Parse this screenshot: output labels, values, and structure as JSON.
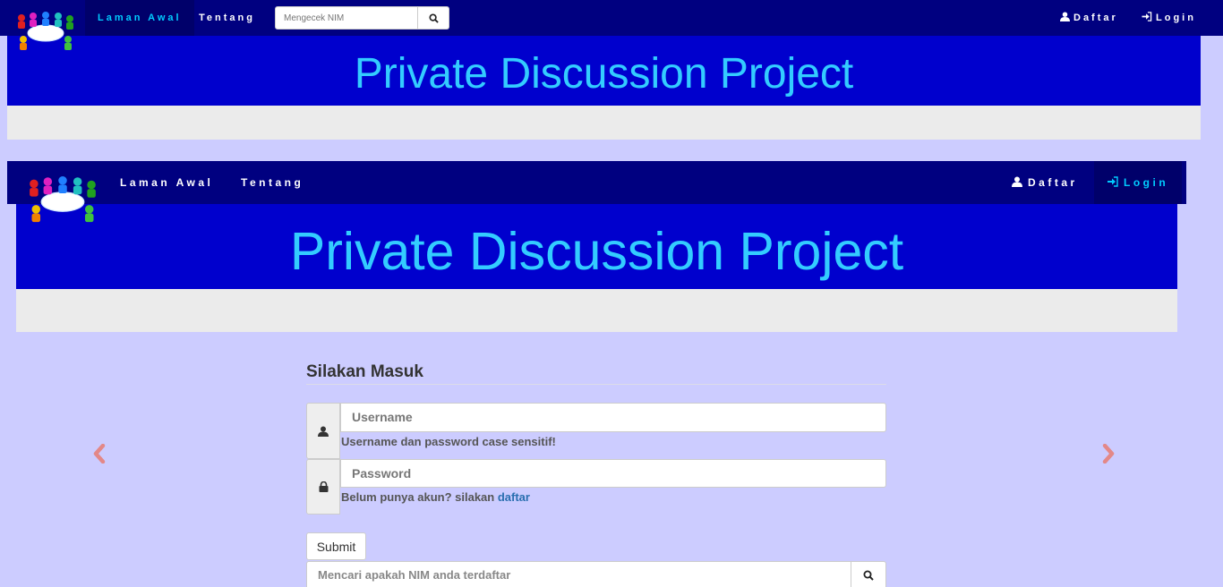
{
  "topnav": {
    "logo": "meeting-people-logo",
    "links": [
      "Laman Awal",
      "Tentang"
    ],
    "search_placeholder": "Mengecek NIM",
    "right_links": [
      "Daftar",
      "Login"
    ]
  },
  "banner": {
    "title": "Private Discussion Project"
  },
  "nav2": {
    "links": [
      "Laman Awal",
      "Tentang"
    ],
    "right_links": [
      "Daftar",
      "Login"
    ]
  },
  "form": {
    "title": "Silakan Masuk",
    "username_placeholder": "Username",
    "username_help": "Username dan password case sensitif!",
    "password_placeholder": "Password",
    "register_prefix": "Belum punya akun? silakan ",
    "register_link": "daftar",
    "submit_label": "Submit",
    "search_placeholder": "Mencari apakah NIM anda terdaftar"
  },
  "colors": {
    "page_bg": "#ccccff",
    "navbar": "#000080",
    "banner": "#0000cd",
    "banner_text": "#33ccff",
    "arrow": "#e38888"
  }
}
